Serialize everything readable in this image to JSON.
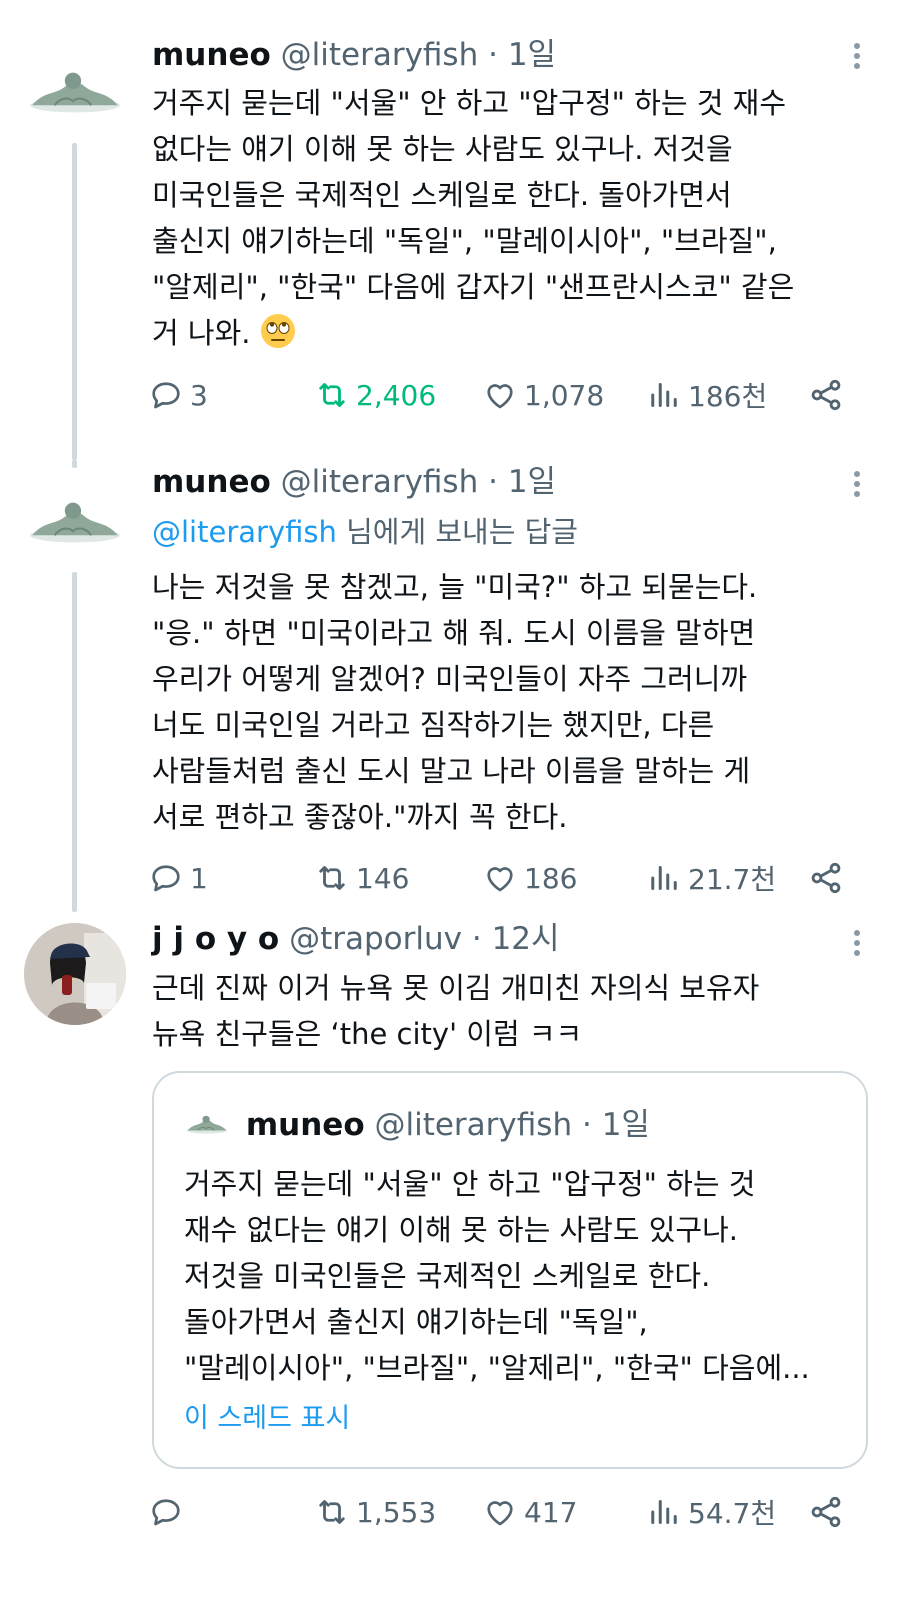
{
  "tweets": [
    {
      "name": "muneo",
      "handle": "@literaryfish",
      "dot": "·",
      "time": "1일",
      "text_main": "거주지 묻는데 \"서울\" 안 하고 \"압구정\" 하는 것 재수\n없다는 얘기 이해 못 하는 사람도 있구나. 저것을\n미국인들은 국제적인 스케일로 한다. 돌아가면서\n출신지 얘기하는데 \"독일\", \"말레이시아\", \"브라질\",\n\"알제리\", \"한국\" 다음에 갑자기 \"샌프란시스코\" 같은\n거 나와.",
      "emoji": "face-with-rolling-eyes",
      "replies": "3",
      "retweets": "2,406",
      "likes": "1,078",
      "views": "186천"
    },
    {
      "name": "muneo",
      "handle": "@literaryfish",
      "dot": "·",
      "time": "1일",
      "replying_mention": "@literaryfish",
      "replying_suffix": " 님에게 보내는 답글",
      "text": "나는 저것을 못 참겠고, 늘 \"미국?\" 하고 되묻는다.\n\"응.\" 하면 \"미국이라고 해 줘. 도시 이름을 말하면\n우리가 어떻게 알겠어? 미국인들이 자주 그러니까\n너도 미국인일 거라고 짐작하기는 했지만, 다른\n사람들처럼 출신 도시 말고 나라 이름을 말하는 게\n서로 편하고 좋잖아.\"까지 꼭 한다.",
      "replies": "1",
      "retweets": "146",
      "likes": "186",
      "views": "21.7천"
    },
    {
      "name": "j j o y o",
      "handle": "@traporluv",
      "dot": "·",
      "time": "12시",
      "text": "근데 진짜 이거 뉴욕 못 이김 개미친 자의식 보유자\n뉴욕 친구들은 ‘the city' 이럼 ㅋㅋ",
      "quote": {
        "name": "muneo",
        "handle": "@literaryfish",
        "dot": "·",
        "time": "1일",
        "text": "거주지 묻는데 \"서울\" 안 하고 \"압구정\" 하는 것\n재수 없다는 얘기 이해 못 하는 사람도 있구나.\n저것을 미국인들은 국제적인 스케일로 한다.\n돌아가면서 출신지 얘기하는데 \"독일\",\n\"말레이시아\", \"브라질\", \"알제리\", \"한국\" 다음에...",
        "show_thread": "이 스레드 표시"
      },
      "replies": "",
      "retweets": "1,553",
      "likes": "417",
      "views": "54.7천"
    }
  ],
  "colors": {
    "text": "#0f1419",
    "secondary": "#536471",
    "link": "#1d9bf0",
    "retweet_active": "#00ba7c",
    "border": "#cfd9de"
  },
  "icons": [
    "reply-icon",
    "retweet-icon",
    "like-icon",
    "views-icon",
    "share-icon",
    "more-icon"
  ]
}
